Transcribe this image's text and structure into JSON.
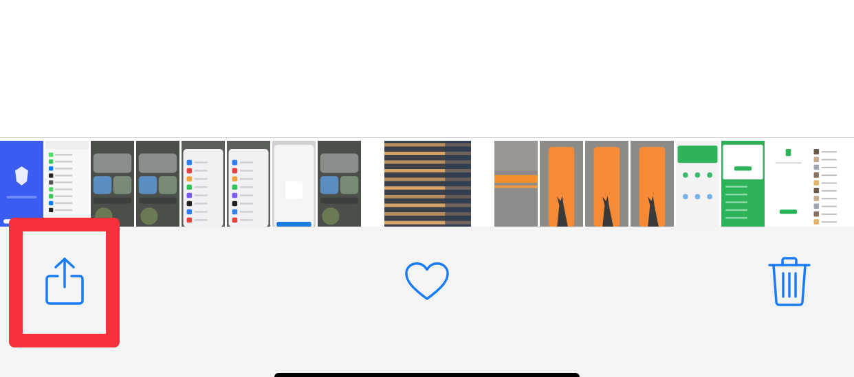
{
  "thumbnails": [
    {
      "kind": "picture",
      "selected": false
    },
    {
      "kind": "picture",
      "selected": false
    },
    {
      "kind": "picture",
      "selected": false
    },
    {
      "kind": "picture",
      "selected": false
    },
    {
      "kind": "picture",
      "selected": false
    },
    {
      "kind": "picture",
      "selected": false
    },
    {
      "kind": "picture",
      "selected": false
    },
    {
      "kind": "picture",
      "selected": false
    },
    {
      "kind": "picture",
      "selected": true
    },
    {
      "kind": "picture",
      "selected": false
    },
    {
      "kind": "picture",
      "selected": false
    },
    {
      "kind": "picture",
      "selected": false
    },
    {
      "kind": "picture",
      "selected": false
    },
    {
      "kind": "picture",
      "selected": false
    },
    {
      "kind": "picture",
      "selected": false
    },
    {
      "kind": "picture",
      "selected": false
    },
    {
      "kind": "picture",
      "selected": false
    }
  ],
  "toolbar": [
    {
      "kind": "share",
      "highlighted": true
    },
    {
      "kind": "favorite",
      "highlighted": false
    },
    {
      "kind": "delete",
      "highlighted": false
    }
  ]
}
